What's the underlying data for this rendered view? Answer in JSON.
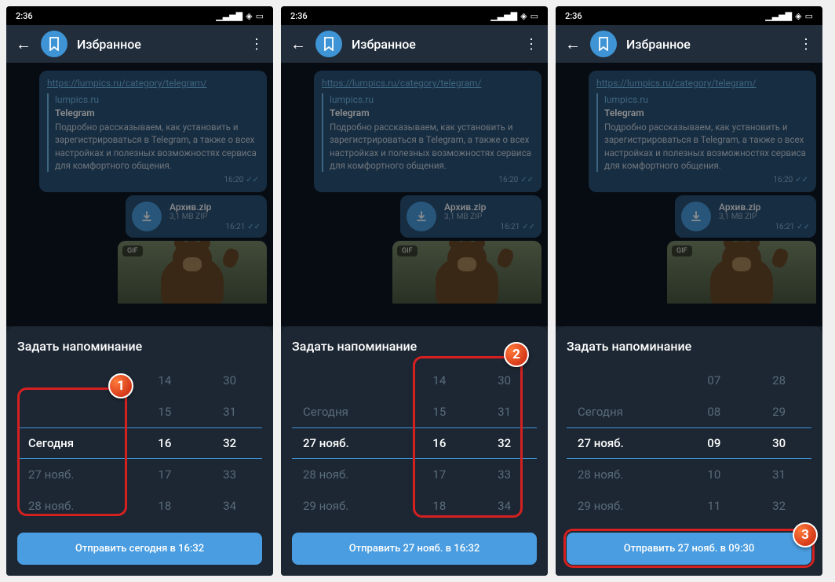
{
  "statusTime": "2:36",
  "headerTitle": "Избранное",
  "link": "https://lumpics.ru/category/telegram/",
  "previewSite": "lumpics.ru",
  "previewTitle": "Telegram",
  "previewDesc": "Подробно рассказываем, как установить и зарегистрироваться в Telegram, а также о всех настройках и полезных возможностях сервиса для комфортного общения.",
  "msgTime1": "16:20",
  "fileName": "Архив.zip",
  "fileSize": "3,1 MB ZIP",
  "msgTime2": "16:21",
  "gifBadge": "GIF",
  "sheetTitle": "Задать напоминание",
  "checks": "✓✓",
  "screens": [
    {
      "dates": [
        "",
        "",
        "Сегодня",
        "27 нояб.",
        "28 нояб."
      ],
      "hours": [
        "14",
        "15",
        "16",
        "17",
        "18"
      ],
      "mins": [
        "30",
        "31",
        "32",
        "33",
        "34"
      ],
      "button": "Отправить сегодня в 16:32",
      "marker": "1"
    },
    {
      "dates": [
        "",
        "Сегодня",
        "27 нояб.",
        "28 нояб.",
        "29 нояб."
      ],
      "hours": [
        "14",
        "15",
        "16",
        "17",
        "18"
      ],
      "mins": [
        "30",
        "31",
        "32",
        "33",
        "34"
      ],
      "button": "Отправить 27 нояб. в 16:32",
      "marker": "2"
    },
    {
      "dates": [
        "",
        "Сегодня",
        "27 нояб.",
        "28 нояб.",
        "29 нояб."
      ],
      "hours": [
        "07",
        "08",
        "09",
        "10",
        "11"
      ],
      "mins": [
        "28",
        "29",
        "30",
        "31",
        "32"
      ],
      "button": "Отправить 27 нояб. в 09:30",
      "marker": "3"
    }
  ]
}
